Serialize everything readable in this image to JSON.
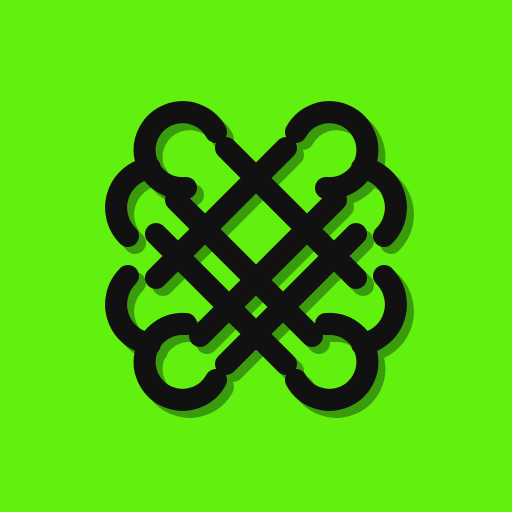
{
  "icon": {
    "background_color": "#62F00E",
    "stroke_color": "#111111",
    "shadow_color": "#3A9B0C",
    "symbol": "four-leaf-clover-knot-icon"
  }
}
